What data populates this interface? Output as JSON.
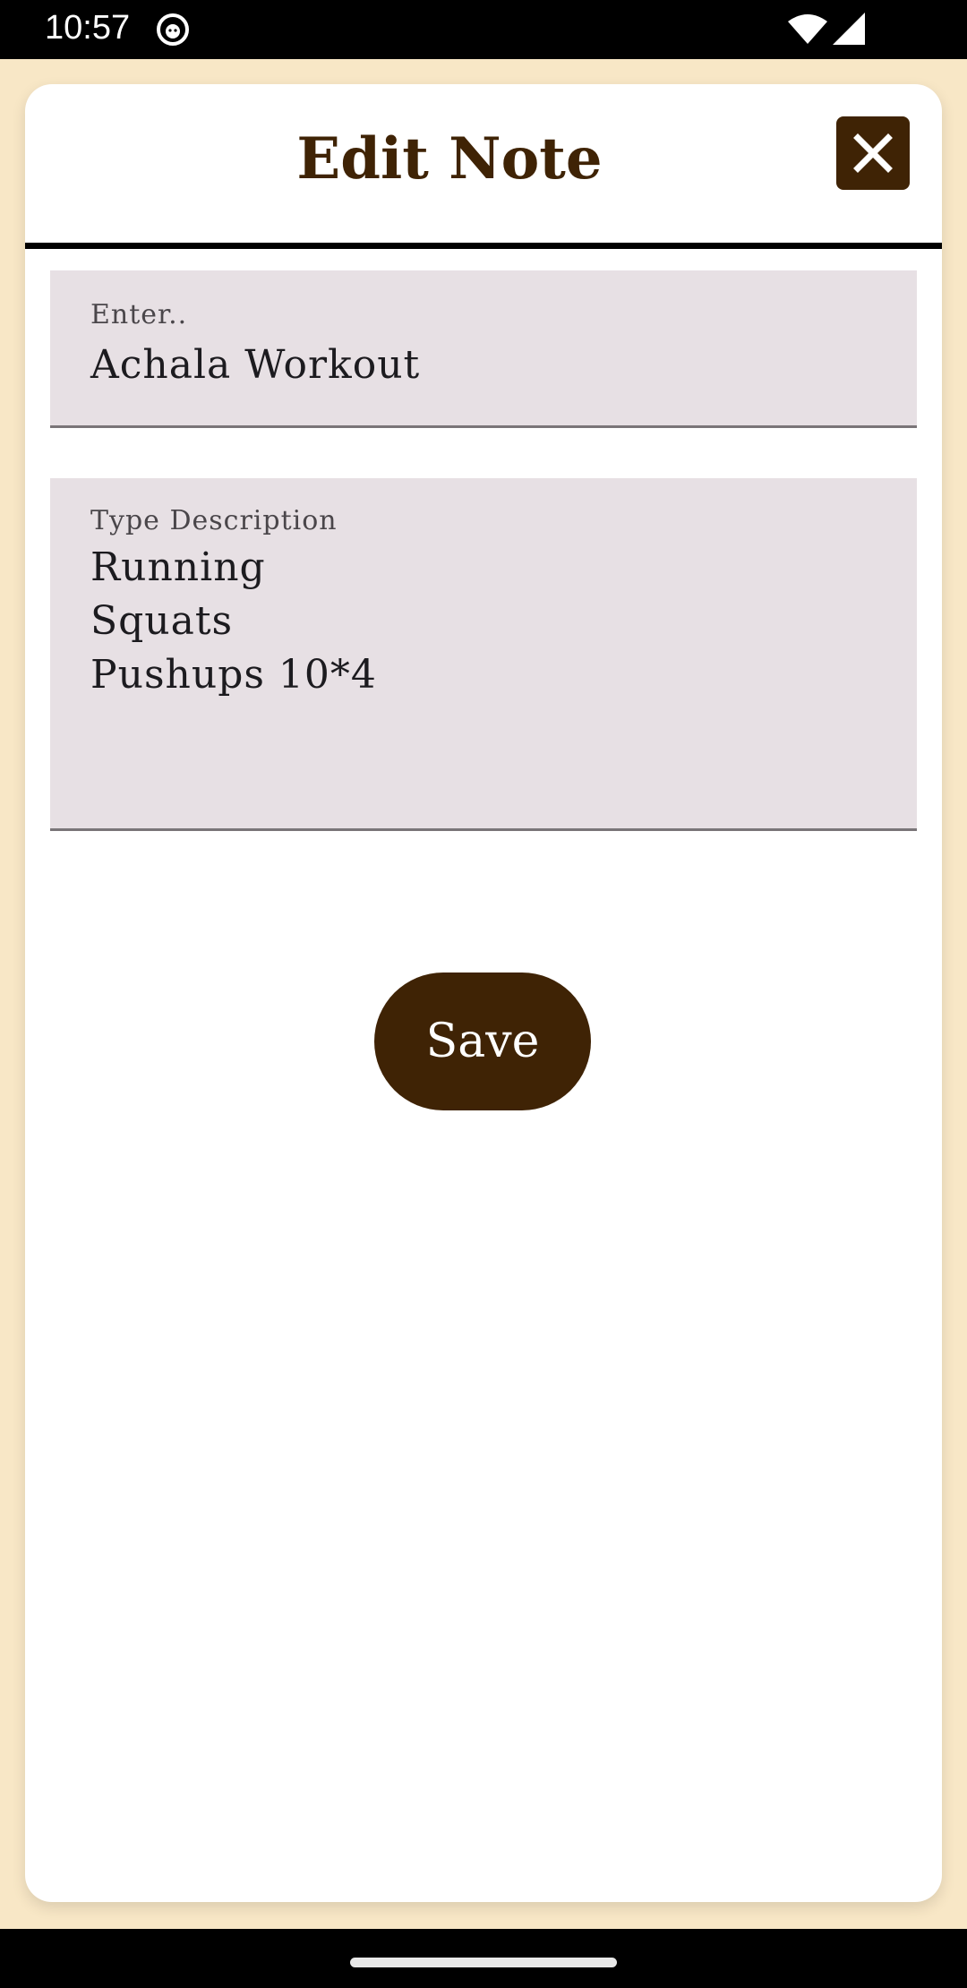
{
  "status_bar": {
    "time": "10:57",
    "icons": [
      "app-notification-icon",
      "wifi-icon",
      "signal-icon"
    ]
  },
  "dialog": {
    "title": "Edit Note",
    "close_icon": "close-icon",
    "title_field": {
      "label": "Enter..",
      "value": "Achala Workout"
    },
    "description_field": {
      "label": "Type Description",
      "lines": [
        "Running",
        "Squats",
        "Pushups 10*4"
      ]
    },
    "save_label": "Save"
  },
  "colors": {
    "accent": "#3f2305",
    "background": "#f8e7c6",
    "field_background": "#e7e0e4"
  }
}
